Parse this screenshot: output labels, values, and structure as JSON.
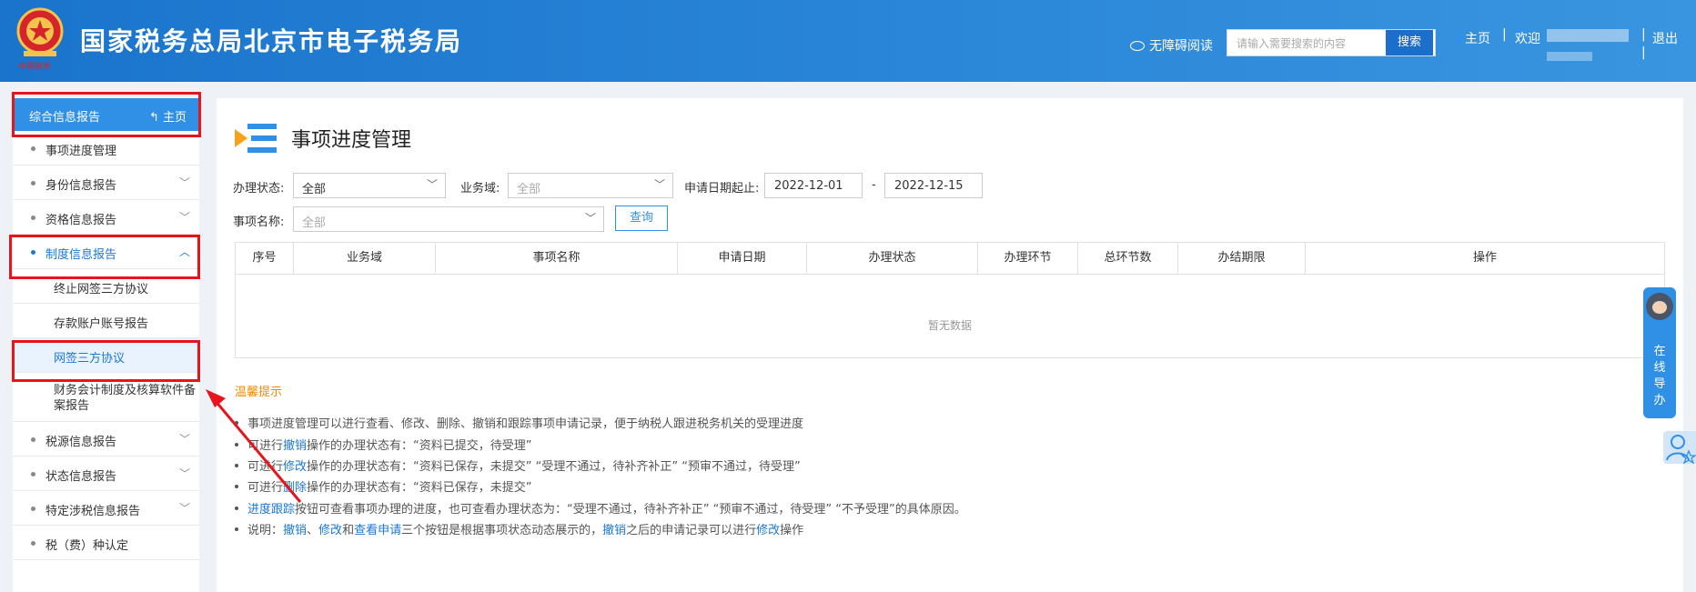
{
  "header": {
    "title": "国家税务总局北京市电子税务局",
    "accessibility_label": "无障碍阅读",
    "search_placeholder": "请输入需要搜索的内容",
    "search_button": "搜索",
    "home_link": "主页",
    "welcome_label": "欢迎",
    "logout_link": "退出",
    "separator": "|",
    "logo_text": "中国税务"
  },
  "sidebar": {
    "section_title": "综合信息报告",
    "home_button": "主页",
    "items": [
      {
        "label": "事项进度管理"
      },
      {
        "label": "身份信息报告"
      },
      {
        "label": "资格信息报告"
      },
      {
        "label": "制度信息报告"
      },
      {
        "label": "税源信息报告"
      },
      {
        "label": "状态信息报告"
      },
      {
        "label": "特定涉税信息报告"
      },
      {
        "label": "税（费）种认定"
      }
    ],
    "sub_items": [
      {
        "label": "终止网签三方协议"
      },
      {
        "label": "存款账户账号报告"
      },
      {
        "label": "网签三方协议"
      },
      {
        "label_line1": "财务会计制度及核算软件备",
        "label_line2": "案报告"
      }
    ]
  },
  "main": {
    "title": "事项进度管理",
    "filters": {
      "status_label": "办理状态:",
      "status_value": "全部",
      "domain_label": "业务域:",
      "domain_value": "全部",
      "date_label": "申请日期起止:",
      "date_from": "2022-12-01",
      "date_sep": "-",
      "date_to": "2022-12-15",
      "name_label": "事项名称:",
      "name_value": "全部",
      "query_button": "查询"
    },
    "table": {
      "columns": [
        "序号",
        "业务域",
        "事项名称",
        "申请日期",
        "办理状态",
        "办理环节",
        "总环节数",
        "办结期限",
        "操作"
      ],
      "empty_text": "暂无数据"
    },
    "tips": {
      "title": "温馨提示",
      "line1": "事项进度管理可以进行查看、修改、删除、撤销和跟踪事项申请记录，便于纳税人跟进税务机关的受理进度",
      "line2_a": "可进行",
      "line2_link": "撤销",
      "line2_b": "操作的办理状态有：“资料已提交，待受理”",
      "line3_a": "可进行",
      "line3_link": "修改",
      "line3_b": "操作的办理状态有：“资料已保存，未提交” “受理不通过，待补齐补正” “预审不通过，待受理”",
      "line4_a": "可进行",
      "line4_link": "删除",
      "line4_b": "操作的办理状态有：“资料已保存，未提交”",
      "line5_link": "进度跟踪",
      "line5_b": "按钮可查看事项办理的进度，也可查看办理状态为：“受理不通过，待补齐补正” “预审不通过，待受理” “不予受理”的具体原因。",
      "line6_a": "说明：",
      "line6_l1": "撤销",
      "line6_s1": "、",
      "line6_l2": "修改",
      "line6_s2": "和",
      "line6_l3": "查看申请",
      "line6_b": "三个按钮是根据事项状态动态展示的，",
      "line6_l4": "撤销",
      "line6_c": "之后的申请记录可以进行",
      "line6_l5": "修改",
      "line6_d": "操作"
    }
  },
  "float": {
    "guide_text_1": "在",
    "guide_text_2": "线",
    "guide_text_3": "导",
    "guide_text_4": "办"
  },
  "colors": {
    "header_blue": "#2a86d8",
    "accent_blue": "#2f90e6",
    "link_blue": "#1b78d6",
    "tip_orange": "#f08c00",
    "annotation_red": "#e8141c"
  }
}
